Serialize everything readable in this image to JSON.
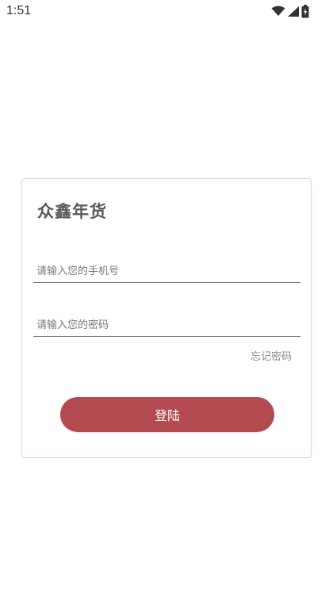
{
  "status_bar": {
    "time": "1:51",
    "icons": [
      "wifi-icon",
      "signal-icon",
      "battery-icon"
    ]
  },
  "login": {
    "title": "众鑫年货",
    "phone_placeholder": "请输入您的手机号",
    "phone_value": "",
    "password_placeholder": "请输入您的密码",
    "password_value": "",
    "forgot_label": "忘记密码",
    "submit_label": "登陆"
  },
  "colors": {
    "accent": "#b34a4f",
    "card_border": "#f3c9d2",
    "title_text": "#5a5a5a"
  }
}
